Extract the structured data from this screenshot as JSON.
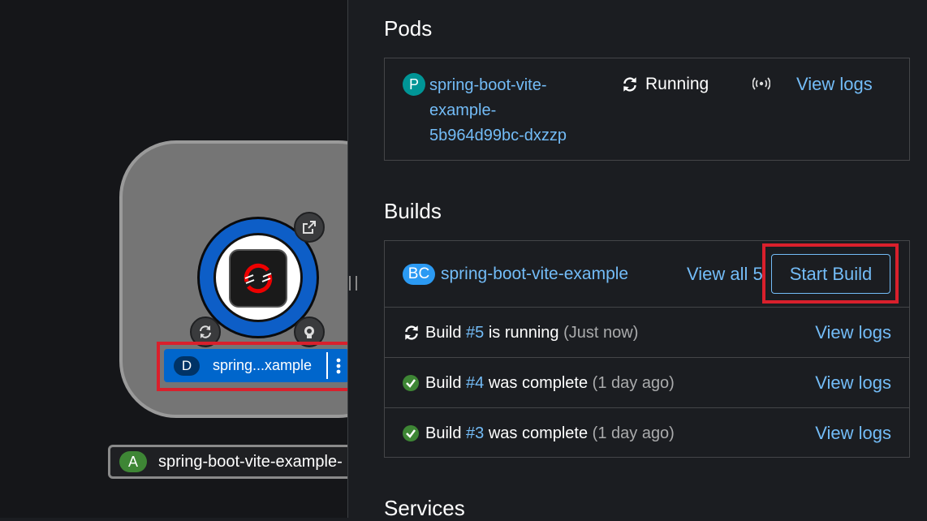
{
  "topology": {
    "node_label": {
      "badge": "D",
      "text": "spring...xample"
    },
    "app_chip": {
      "badge": "A",
      "text": "spring-boot-vite-example-"
    }
  },
  "panel": {
    "pods_heading": "Pods",
    "pod": {
      "badge": "P",
      "name_lines": [
        "spring-boot-vite-",
        "example-",
        "5b964d99bc-dxzzp"
      ],
      "status": "Running",
      "view_logs": "View logs"
    },
    "builds_heading": "Builds",
    "build_config": {
      "badge": "BC",
      "name": "spring-boot-vite-example",
      "view_all": "View all 5",
      "start_build": "Start Build"
    },
    "builds": [
      {
        "prefix": "Build ",
        "number": "#5",
        "status": " is running ",
        "time": "(Just now)",
        "view_logs": "View logs",
        "icon": "sync-icon"
      },
      {
        "prefix": "Build ",
        "number": "#4",
        "status": " was complete ",
        "time": "(1 day ago)",
        "view_logs": "View logs",
        "icon": "check-circle-icon"
      },
      {
        "prefix": "Build ",
        "number": "#3",
        "status": " was complete ",
        "time": "(1 day ago)",
        "view_logs": "View logs",
        "icon": "check-circle-icon"
      }
    ],
    "services_heading": "Services"
  },
  "colors": {
    "link": "#73bcf7",
    "highlight": "#d9202c",
    "success": "#3e8635",
    "accent": "#0066cc"
  }
}
